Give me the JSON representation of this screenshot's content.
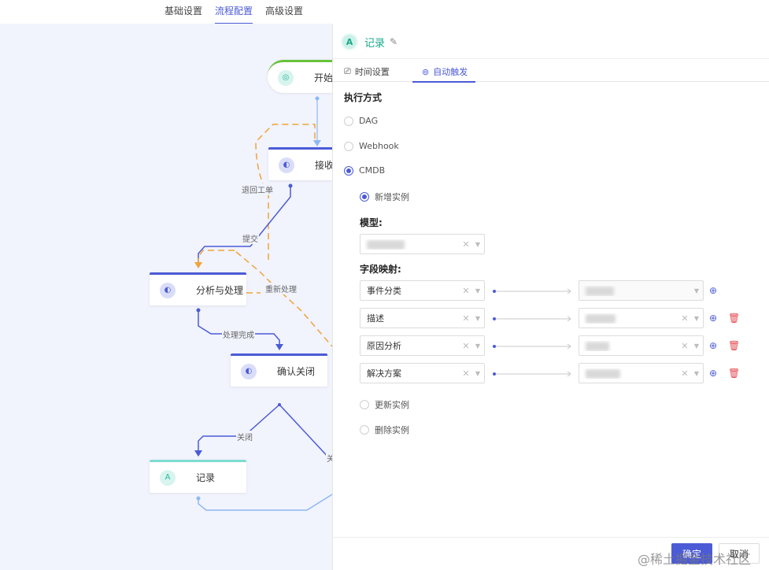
{
  "top_tabs": [
    "基础设置",
    "流程配置",
    "高级设置"
  ],
  "active_top_tab": "流程配置",
  "flow": {
    "nodes": {
      "start": "开始",
      "receive": "接收与",
      "analyze": "分析与处理",
      "confirm": "确认关闭",
      "record": "记录"
    },
    "edges": {
      "return_ticket": "退回工单",
      "submit": "提交",
      "reprocess": "重新处理",
      "processed": "处理完成",
      "close": "关闭",
      "close_partial": "关"
    }
  },
  "panel": {
    "title": "记录",
    "tabs": [
      "时间设置",
      "自动触发"
    ],
    "active_tab": "自动触发",
    "execution_mode_label": "执行方式",
    "modes": [
      "DAG",
      "Webhook",
      "CMDB"
    ],
    "selected_mode": "CMDB",
    "cmdb_actions": [
      "新增实例",
      "更新实例",
      "删除实例"
    ],
    "selected_action": "新增实例",
    "model_label": "模型:",
    "field_mapping_label": "字段映射:",
    "mappings": [
      {
        "source": "事件分类"
      },
      {
        "source": "描述"
      },
      {
        "source": "原因分析"
      },
      {
        "source": "解决方案"
      }
    ],
    "confirm_button": "确定",
    "cancel_button": "取消"
  },
  "watermark": "@稀土掘金技术社区",
  "colors": {
    "accent": "#4b5bd6",
    "canvas": "#f1f3fd",
    "edge_orange": "#f0a43a",
    "teal": "#1aa88c",
    "delete": "#e5484d"
  }
}
